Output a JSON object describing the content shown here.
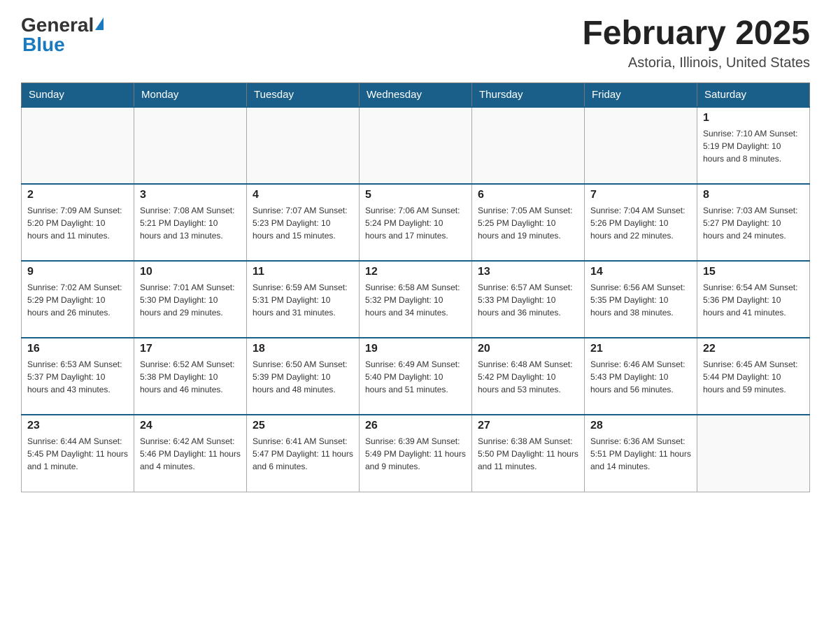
{
  "header": {
    "logo_general": "General",
    "logo_blue": "Blue",
    "month_title": "February 2025",
    "location": "Astoria, Illinois, United States"
  },
  "weekdays": [
    "Sunday",
    "Monday",
    "Tuesday",
    "Wednesday",
    "Thursday",
    "Friday",
    "Saturday"
  ],
  "weeks": [
    [
      {
        "day": "",
        "info": ""
      },
      {
        "day": "",
        "info": ""
      },
      {
        "day": "",
        "info": ""
      },
      {
        "day": "",
        "info": ""
      },
      {
        "day": "",
        "info": ""
      },
      {
        "day": "",
        "info": ""
      },
      {
        "day": "1",
        "info": "Sunrise: 7:10 AM\nSunset: 5:19 PM\nDaylight: 10 hours and 8 minutes."
      }
    ],
    [
      {
        "day": "2",
        "info": "Sunrise: 7:09 AM\nSunset: 5:20 PM\nDaylight: 10 hours and 11 minutes."
      },
      {
        "day": "3",
        "info": "Sunrise: 7:08 AM\nSunset: 5:21 PM\nDaylight: 10 hours and 13 minutes."
      },
      {
        "day": "4",
        "info": "Sunrise: 7:07 AM\nSunset: 5:23 PM\nDaylight: 10 hours and 15 minutes."
      },
      {
        "day": "5",
        "info": "Sunrise: 7:06 AM\nSunset: 5:24 PM\nDaylight: 10 hours and 17 minutes."
      },
      {
        "day": "6",
        "info": "Sunrise: 7:05 AM\nSunset: 5:25 PM\nDaylight: 10 hours and 19 minutes."
      },
      {
        "day": "7",
        "info": "Sunrise: 7:04 AM\nSunset: 5:26 PM\nDaylight: 10 hours and 22 minutes."
      },
      {
        "day": "8",
        "info": "Sunrise: 7:03 AM\nSunset: 5:27 PM\nDaylight: 10 hours and 24 minutes."
      }
    ],
    [
      {
        "day": "9",
        "info": "Sunrise: 7:02 AM\nSunset: 5:29 PM\nDaylight: 10 hours and 26 minutes."
      },
      {
        "day": "10",
        "info": "Sunrise: 7:01 AM\nSunset: 5:30 PM\nDaylight: 10 hours and 29 minutes."
      },
      {
        "day": "11",
        "info": "Sunrise: 6:59 AM\nSunset: 5:31 PM\nDaylight: 10 hours and 31 minutes."
      },
      {
        "day": "12",
        "info": "Sunrise: 6:58 AM\nSunset: 5:32 PM\nDaylight: 10 hours and 34 minutes."
      },
      {
        "day": "13",
        "info": "Sunrise: 6:57 AM\nSunset: 5:33 PM\nDaylight: 10 hours and 36 minutes."
      },
      {
        "day": "14",
        "info": "Sunrise: 6:56 AM\nSunset: 5:35 PM\nDaylight: 10 hours and 38 minutes."
      },
      {
        "day": "15",
        "info": "Sunrise: 6:54 AM\nSunset: 5:36 PM\nDaylight: 10 hours and 41 minutes."
      }
    ],
    [
      {
        "day": "16",
        "info": "Sunrise: 6:53 AM\nSunset: 5:37 PM\nDaylight: 10 hours and 43 minutes."
      },
      {
        "day": "17",
        "info": "Sunrise: 6:52 AM\nSunset: 5:38 PM\nDaylight: 10 hours and 46 minutes."
      },
      {
        "day": "18",
        "info": "Sunrise: 6:50 AM\nSunset: 5:39 PM\nDaylight: 10 hours and 48 minutes."
      },
      {
        "day": "19",
        "info": "Sunrise: 6:49 AM\nSunset: 5:40 PM\nDaylight: 10 hours and 51 minutes."
      },
      {
        "day": "20",
        "info": "Sunrise: 6:48 AM\nSunset: 5:42 PM\nDaylight: 10 hours and 53 minutes."
      },
      {
        "day": "21",
        "info": "Sunrise: 6:46 AM\nSunset: 5:43 PM\nDaylight: 10 hours and 56 minutes."
      },
      {
        "day": "22",
        "info": "Sunrise: 6:45 AM\nSunset: 5:44 PM\nDaylight: 10 hours and 59 minutes."
      }
    ],
    [
      {
        "day": "23",
        "info": "Sunrise: 6:44 AM\nSunset: 5:45 PM\nDaylight: 11 hours and 1 minute."
      },
      {
        "day": "24",
        "info": "Sunrise: 6:42 AM\nSunset: 5:46 PM\nDaylight: 11 hours and 4 minutes."
      },
      {
        "day": "25",
        "info": "Sunrise: 6:41 AM\nSunset: 5:47 PM\nDaylight: 11 hours and 6 minutes."
      },
      {
        "day": "26",
        "info": "Sunrise: 6:39 AM\nSunset: 5:49 PM\nDaylight: 11 hours and 9 minutes."
      },
      {
        "day": "27",
        "info": "Sunrise: 6:38 AM\nSunset: 5:50 PM\nDaylight: 11 hours and 11 minutes."
      },
      {
        "day": "28",
        "info": "Sunrise: 6:36 AM\nSunset: 5:51 PM\nDaylight: 11 hours and 14 minutes."
      },
      {
        "day": "",
        "info": ""
      }
    ]
  ]
}
